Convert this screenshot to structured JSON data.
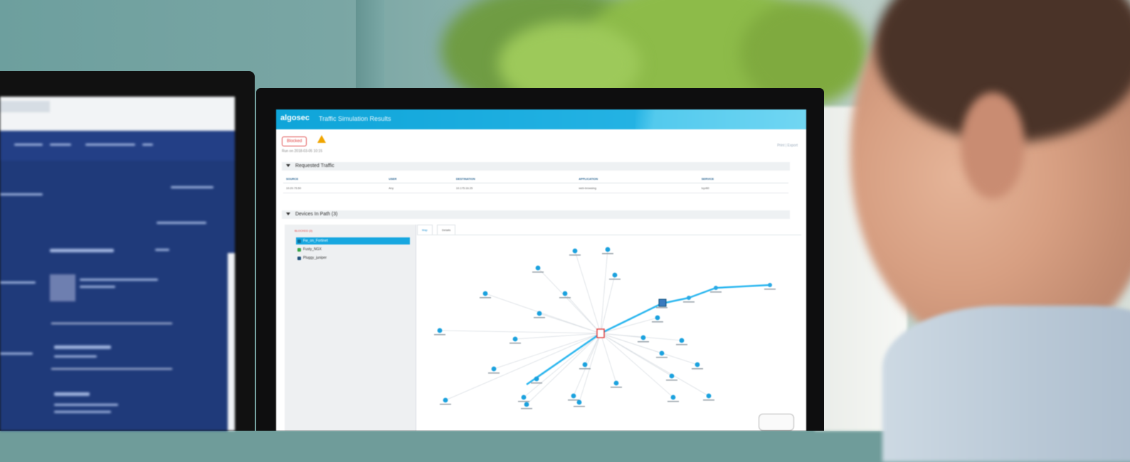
{
  "app": {
    "logo": "algosec",
    "title": "Traffic Simulation Results"
  },
  "status": {
    "badge": "Blocked",
    "run_text": "Run on 2018-03-05 10:15",
    "top_right": "Print | Export"
  },
  "sections": {
    "requested_traffic": "Requested Traffic",
    "devices_in_path": "Devices In Path (3)"
  },
  "traffic_table": {
    "headers": [
      "SOURCE",
      "USER",
      "DESTINATION",
      "APPLICATION",
      "SERVICE"
    ],
    "row": [
      "10.20.75.50",
      "Any",
      "10.175.16.25",
      "web-browsing",
      "tcp/80"
    ]
  },
  "tree": {
    "root": "BLOCKED (3)",
    "items": [
      "Fw_on_Fortinet",
      "Fusty_NGX",
      "Pluggy_juniper"
    ]
  },
  "tabs": [
    "Map",
    "Details"
  ],
  "colors": {
    "accent": "#17a7e0",
    "blocked": "#e04040",
    "warning": "#f0a500"
  },
  "icons": [
    "warning-icon",
    "network-node-icon",
    "firewall-icon",
    "caret-down-icon"
  ]
}
